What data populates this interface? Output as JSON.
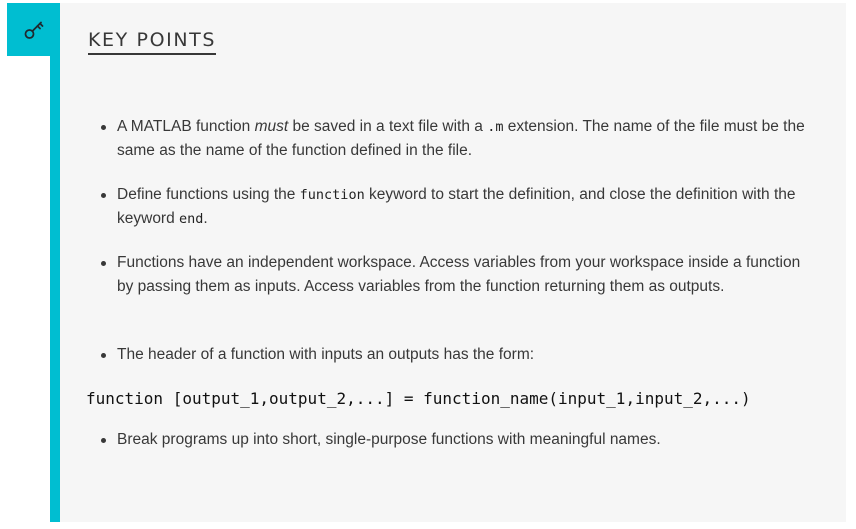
{
  "callout": {
    "icon": "key-icon",
    "accent_color": "#00bed1",
    "background_color": "#f6f6f6",
    "heading": "KEY POINTS"
  },
  "points": [
    {
      "pre": "A MATLAB function ",
      "em": "must",
      "mid": " be saved in a text file with a ",
      "code": ".m",
      "post": " extension. The name of the file must be the same as the name of the function defined in the file."
    },
    {
      "pre": "Define functions using the ",
      "code1": "function",
      "mid": " keyword to start the definition, and close the definition with the keyword ",
      "code2": "end",
      "post": "."
    },
    {
      "text": "Functions have an independent workspace. Access variables from your workspace inside a function by passing them as inputs. Access variables from the function returning them as outputs."
    },
    {
      "text": "The header of a function with inputs an outputs has the form:"
    },
    {
      "text": "Break programs up into short, single-purpose functions with meaningful names."
    }
  ],
  "code_example": "function [output_1,output_2,...] = function_name(input_1,input_2,...)"
}
